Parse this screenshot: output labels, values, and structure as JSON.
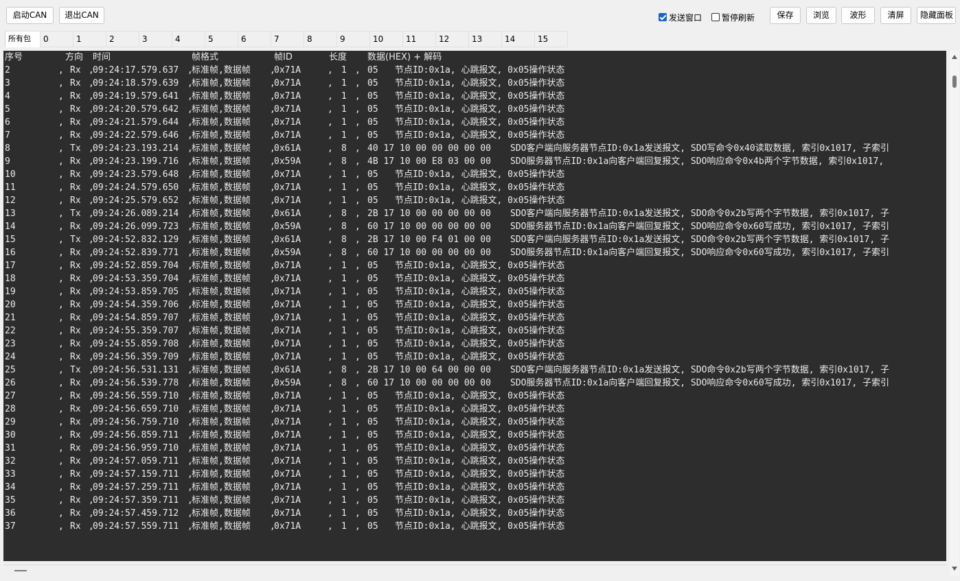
{
  "toolbar": {
    "start_can": "启动CAN",
    "exit_can": "退出CAN",
    "send_window": "发送窗口",
    "send_window_checked": true,
    "pause_refresh": "暂停刷新",
    "pause_refresh_checked": false,
    "save": "保存",
    "browse": "浏览",
    "waveform": "波形",
    "clear": "清屏",
    "hide_panel": "隐藏面板"
  },
  "tabs": [
    "所有包",
    "0",
    "1",
    "2",
    "3",
    "4",
    "5",
    "6",
    "7",
    "8",
    "9",
    "10",
    "11",
    "12",
    "13",
    "14",
    "15"
  ],
  "active_tab": "所有包",
  "console": {
    "headers": {
      "seq": "序号",
      "dir": "方向",
      "time": "时间",
      "format": "帧格式",
      "id": "帧ID",
      "len": "长度",
      "data": "数据(HEX) + 解码"
    },
    "rows": [
      {
        "seq": "2",
        "dir": "Rx",
        "time": "09:24:17.579.637",
        "format": "标准帧,数据帧",
        "id": "0x71A",
        "len": "1",
        "data": "05",
        "decode": "节点ID:0x1a, 心跳报文, 0x05操作状态"
      },
      {
        "seq": "3",
        "dir": "Rx",
        "time": "09:24:18.579.639",
        "format": "标准帧,数据帧",
        "id": "0x71A",
        "len": "1",
        "data": "05",
        "decode": "节点ID:0x1a, 心跳报文, 0x05操作状态"
      },
      {
        "seq": "4",
        "dir": "Rx",
        "time": "09:24:19.579.641",
        "format": "标准帧,数据帧",
        "id": "0x71A",
        "len": "1",
        "data": "05",
        "decode": "节点ID:0x1a, 心跳报文, 0x05操作状态"
      },
      {
        "seq": "5",
        "dir": "Rx",
        "time": "09:24:20.579.642",
        "format": "标准帧,数据帧",
        "id": "0x71A",
        "len": "1",
        "data": "05",
        "decode": "节点ID:0x1a, 心跳报文, 0x05操作状态"
      },
      {
        "seq": "6",
        "dir": "Rx",
        "time": "09:24:21.579.644",
        "format": "标准帧,数据帧",
        "id": "0x71A",
        "len": "1",
        "data": "05",
        "decode": "节点ID:0x1a, 心跳报文, 0x05操作状态"
      },
      {
        "seq": "7",
        "dir": "Rx",
        "time": "09:24:22.579.646",
        "format": "标准帧,数据帧",
        "id": "0x71A",
        "len": "1",
        "data": "05",
        "decode": "节点ID:0x1a, 心跳报文, 0x05操作状态"
      },
      {
        "seq": "8",
        "dir": "Tx",
        "time": "09:24:23.193.214",
        "format": "标准帧,数据帧",
        "id": "0x61A",
        "len": "8",
        "data": "40 17 10 00 00 00 00 00",
        "decode": "SDO客户端向服务器节点ID:0x1a发送报文, SDO写命令0x40读取数据, 索引0x1017, 子索引"
      },
      {
        "seq": "9",
        "dir": "Rx",
        "time": "09:24:23.199.716",
        "format": "标准帧,数据帧",
        "id": "0x59A",
        "len": "8",
        "data": "4B 17 10 00 E8 03 00 00",
        "decode": "SDO服务器节点ID:0x1a向客户端回复报文, SDO响应命令0x4b两个字节数据, 索引0x1017,"
      },
      {
        "seq": "10",
        "dir": "Rx",
        "time": "09:24:23.579.648",
        "format": "标准帧,数据帧",
        "id": "0x71A",
        "len": "1",
        "data": "05",
        "decode": "节点ID:0x1a, 心跳报文, 0x05操作状态"
      },
      {
        "seq": "11",
        "dir": "Rx",
        "time": "09:24:24.579.650",
        "format": "标准帧,数据帧",
        "id": "0x71A",
        "len": "1",
        "data": "05",
        "decode": "节点ID:0x1a, 心跳报文, 0x05操作状态"
      },
      {
        "seq": "12",
        "dir": "Rx",
        "time": "09:24:25.579.652",
        "format": "标准帧,数据帧",
        "id": "0x71A",
        "len": "1",
        "data": "05",
        "decode": "节点ID:0x1a, 心跳报文, 0x05操作状态"
      },
      {
        "seq": "13",
        "dir": "Tx",
        "time": "09:24:26.089.214",
        "format": "标准帧,数据帧",
        "id": "0x61A",
        "len": "8",
        "data": "2B 17 10 00 00 00 00 00",
        "decode": "SDO客户端向服务器节点ID:0x1a发送报文, SDO命令0x2b写两个字节数据, 索引0x1017, 子"
      },
      {
        "seq": "14",
        "dir": "Rx",
        "time": "09:24:26.099.723",
        "format": "标准帧,数据帧",
        "id": "0x59A",
        "len": "8",
        "data": "60 17 10 00 00 00 00 00",
        "decode": "SDO服务器节点ID:0x1a向客户端回复报文, SDO响应命令0x60写成功, 索引0x1017, 子索引"
      },
      {
        "seq": "15",
        "dir": "Tx",
        "time": "09:24:52.832.129",
        "format": "标准帧,数据帧",
        "id": "0x61A",
        "len": "8",
        "data": "2B 17 10 00 F4 01 00 00",
        "decode": "SDO客户端向服务器节点ID:0x1a发送报文, SDO命令0x2b写两个字节数据, 索引0x1017, 子"
      },
      {
        "seq": "16",
        "dir": "Rx",
        "time": "09:24:52.839.771",
        "format": "标准帧,数据帧",
        "id": "0x59A",
        "len": "8",
        "data": "60 17 10 00 00 00 00 00",
        "decode": "SDO服务器节点ID:0x1a向客户端回复报文, SDO响应命令0x60写成功, 索引0x1017, 子索引"
      },
      {
        "seq": "17",
        "dir": "Rx",
        "time": "09:24:52.859.704",
        "format": "标准帧,数据帧",
        "id": "0x71A",
        "len": "1",
        "data": "05",
        "decode": "节点ID:0x1a, 心跳报文, 0x05操作状态"
      },
      {
        "seq": "18",
        "dir": "Rx",
        "time": "09:24:53.359.704",
        "format": "标准帧,数据帧",
        "id": "0x71A",
        "len": "1",
        "data": "05",
        "decode": "节点ID:0x1a, 心跳报文, 0x05操作状态"
      },
      {
        "seq": "19",
        "dir": "Rx",
        "time": "09:24:53.859.705",
        "format": "标准帧,数据帧",
        "id": "0x71A",
        "len": "1",
        "data": "05",
        "decode": "节点ID:0x1a, 心跳报文, 0x05操作状态"
      },
      {
        "seq": "20",
        "dir": "Rx",
        "time": "09:24:54.359.706",
        "format": "标准帧,数据帧",
        "id": "0x71A",
        "len": "1",
        "data": "05",
        "decode": "节点ID:0x1a, 心跳报文, 0x05操作状态"
      },
      {
        "seq": "21",
        "dir": "Rx",
        "time": "09:24:54.859.707",
        "format": "标准帧,数据帧",
        "id": "0x71A",
        "len": "1",
        "data": "05",
        "decode": "节点ID:0x1a, 心跳报文, 0x05操作状态"
      },
      {
        "seq": "22",
        "dir": "Rx",
        "time": "09:24:55.359.707",
        "format": "标准帧,数据帧",
        "id": "0x71A",
        "len": "1",
        "data": "05",
        "decode": "节点ID:0x1a, 心跳报文, 0x05操作状态"
      },
      {
        "seq": "23",
        "dir": "Rx",
        "time": "09:24:55.859.708",
        "format": "标准帧,数据帧",
        "id": "0x71A",
        "len": "1",
        "data": "05",
        "decode": "节点ID:0x1a, 心跳报文, 0x05操作状态"
      },
      {
        "seq": "24",
        "dir": "Rx",
        "time": "09:24:56.359.709",
        "format": "标准帧,数据帧",
        "id": "0x71A",
        "len": "1",
        "data": "05",
        "decode": "节点ID:0x1a, 心跳报文, 0x05操作状态"
      },
      {
        "seq": "25",
        "dir": "Tx",
        "time": "09:24:56.531.131",
        "format": "标准帧,数据帧",
        "id": "0x61A",
        "len": "8",
        "data": "2B 17 10 00 64 00 00 00",
        "decode": "SDO客户端向服务器节点ID:0x1a发送报文, SDO命令0x2b写两个字节数据, 索引0x1017, 子"
      },
      {
        "seq": "26",
        "dir": "Rx",
        "time": "09:24:56.539.778",
        "format": "标准帧,数据帧",
        "id": "0x59A",
        "len": "8",
        "data": "60 17 10 00 00 00 00 00",
        "decode": "SDO服务器节点ID:0x1a向客户端回复报文, SDO响应命令0x60写成功, 索引0x1017, 子索引"
      },
      {
        "seq": "27",
        "dir": "Rx",
        "time": "09:24:56.559.710",
        "format": "标准帧,数据帧",
        "id": "0x71A",
        "len": "1",
        "data": "05",
        "decode": "节点ID:0x1a, 心跳报文, 0x05操作状态"
      },
      {
        "seq": "28",
        "dir": "Rx",
        "time": "09:24:56.659.710",
        "format": "标准帧,数据帧",
        "id": "0x71A",
        "len": "1",
        "data": "05",
        "decode": "节点ID:0x1a, 心跳报文, 0x05操作状态"
      },
      {
        "seq": "29",
        "dir": "Rx",
        "time": "09:24:56.759.710",
        "format": "标准帧,数据帧",
        "id": "0x71A",
        "len": "1",
        "data": "05",
        "decode": "节点ID:0x1a, 心跳报文, 0x05操作状态"
      },
      {
        "seq": "30",
        "dir": "Rx",
        "time": "09:24:56.859.711",
        "format": "标准帧,数据帧",
        "id": "0x71A",
        "len": "1",
        "data": "05",
        "decode": "节点ID:0x1a, 心跳报文, 0x05操作状态"
      },
      {
        "seq": "31",
        "dir": "Rx",
        "time": "09:24:56.959.710",
        "format": "标准帧,数据帧",
        "id": "0x71A",
        "len": "1",
        "data": "05",
        "decode": "节点ID:0x1a, 心跳报文, 0x05操作状态"
      },
      {
        "seq": "32",
        "dir": "Rx",
        "time": "09:24:57.059.711",
        "format": "标准帧,数据帧",
        "id": "0x71A",
        "len": "1",
        "data": "05",
        "decode": "节点ID:0x1a, 心跳报文, 0x05操作状态"
      },
      {
        "seq": "33",
        "dir": "Rx",
        "time": "09:24:57.159.711",
        "format": "标准帧,数据帧",
        "id": "0x71A",
        "len": "1",
        "data": "05",
        "decode": "节点ID:0x1a, 心跳报文, 0x05操作状态"
      },
      {
        "seq": "34",
        "dir": "Rx",
        "time": "09:24:57.259.711",
        "format": "标准帧,数据帧",
        "id": "0x71A",
        "len": "1",
        "data": "05",
        "decode": "节点ID:0x1a, 心跳报文, 0x05操作状态"
      },
      {
        "seq": "35",
        "dir": "Rx",
        "time": "09:24:57.359.711",
        "format": "标准帧,数据帧",
        "id": "0x71A",
        "len": "1",
        "data": "05",
        "decode": "节点ID:0x1a, 心跳报文, 0x05操作状态"
      },
      {
        "seq": "36",
        "dir": "Rx",
        "time": "09:24:57.459.712",
        "format": "标准帧,数据帧",
        "id": "0x71A",
        "len": "1",
        "data": "05",
        "decode": "节点ID:0x1a, 心跳报文, 0x05操作状态"
      },
      {
        "seq": "37",
        "dir": "Rx",
        "time": "09:24:57.559.711",
        "format": "标准帧,数据帧",
        "id": "0x71A",
        "len": "1",
        "data": "05",
        "decode": "节点ID:0x1a, 心跳报文, 0x05操作状态"
      }
    ]
  },
  "colors": {
    "console_bg": "#2d2d2d",
    "console_text": "#ececec",
    "checkbox_accent": "#1a64c8"
  }
}
